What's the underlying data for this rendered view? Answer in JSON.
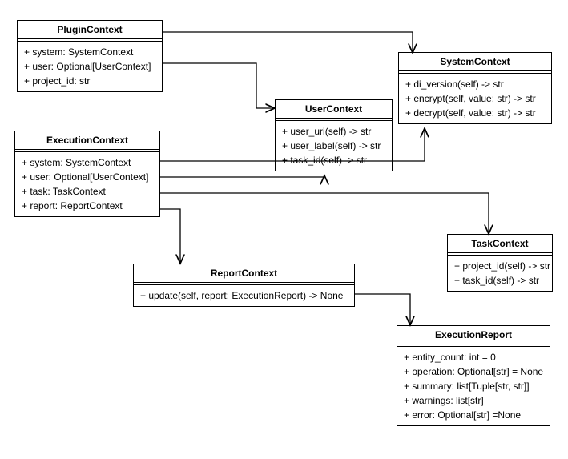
{
  "classes": {
    "PluginContext": {
      "title": "PluginContext",
      "members": [
        "+ system: SystemContext",
        "+ user: Optional[UserContext]",
        "+ project_id: str"
      ]
    },
    "SystemContext": {
      "title": "SystemContext",
      "members": [
        "+ di_version(self) -> str",
        "+ encrypt(self, value: str) -> str",
        "+ decrypt(self, value: str) -> str"
      ]
    },
    "UserContext": {
      "title": "UserContext",
      "members": [
        "+ user_uri(self) -> str",
        "+ user_label(self) -> str",
        "+ task_id(self) -> str"
      ]
    },
    "ExecutionContext": {
      "title": "ExecutionContext",
      "members": [
        "+ system: SystemContext",
        "+ user: Optional[UserContext]",
        "+ task: TaskContext",
        "+ report: ReportContext"
      ]
    },
    "TaskContext": {
      "title": "TaskContext",
      "members": [
        "+ project_id(self) -> str",
        "+ task_id(self) -> str"
      ]
    },
    "ReportContext": {
      "title": "ReportContext",
      "members": [
        "+ update(self, report: ExecutionReport) -> None"
      ]
    },
    "ExecutionReport": {
      "title": "ExecutionReport",
      "members": [
        "+ entity_count: int = 0",
        "+ operation: Optional[str] = None",
        "+ summary: list[Tuple[str, str]]",
        "+ warnings: list[str]",
        "+ error: Optional[str] =None"
      ]
    }
  },
  "chart_data": {
    "type": "uml-class",
    "classes": [
      {
        "name": "PluginContext",
        "attributes": [
          "system: SystemContext",
          "user: Optional[UserContext]",
          "project_id: str"
        ]
      },
      {
        "name": "SystemContext",
        "methods": [
          "di_version(self) -> str",
          "encrypt(self, value: str) -> str",
          "decrypt(self, value: str) -> str"
        ]
      },
      {
        "name": "UserContext",
        "methods": [
          "user_uri(self) -> str",
          "user_label(self) -> str",
          "task_id(self) -> str"
        ]
      },
      {
        "name": "ExecutionContext",
        "attributes": [
          "system: SystemContext",
          "user: Optional[UserContext]",
          "task: TaskContext",
          "report: ReportContext"
        ]
      },
      {
        "name": "TaskContext",
        "methods": [
          "project_id(self) -> str",
          "task_id(self) -> str"
        ]
      },
      {
        "name": "ReportContext",
        "methods": [
          "update(self, report: ExecutionReport) -> None"
        ]
      },
      {
        "name": "ExecutionReport",
        "attributes": [
          "entity_count: int = 0",
          "operation: Optional[str] = None",
          "summary: list[Tuple[str, str]]",
          "warnings: list[str]",
          "error: Optional[str] =None"
        ]
      }
    ],
    "associations": [
      {
        "from": "PluginContext",
        "to": "SystemContext"
      },
      {
        "from": "PluginContext",
        "to": "UserContext"
      },
      {
        "from": "ExecutionContext",
        "to": "SystemContext"
      },
      {
        "from": "ExecutionContext",
        "to": "UserContext"
      },
      {
        "from": "ExecutionContext",
        "to": "TaskContext"
      },
      {
        "from": "ExecutionContext",
        "to": "ReportContext"
      },
      {
        "from": "ReportContext",
        "to": "ExecutionReport"
      }
    ]
  }
}
